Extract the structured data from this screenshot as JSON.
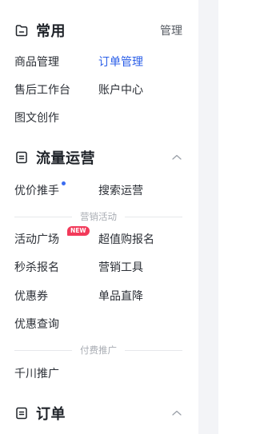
{
  "sections": {
    "common": {
      "title": "常用",
      "manage_label": "管理",
      "items": [
        "商品管理",
        "订单管理",
        "售后工作台",
        "账户中心",
        "图文创作"
      ]
    },
    "traffic": {
      "title": "流量运营",
      "items": [
        "优价推手",
        "搜索运营"
      ],
      "marketing_divider": "营销活动",
      "marketing_items": [
        "活动广场",
        "超值购报名",
        "秒杀报名",
        "营销工具",
        "优惠券",
        "单品直降",
        "优惠查询"
      ],
      "new_badge": "NEW",
      "paid_divider": "付费推广",
      "paid_items": [
        "千川推广"
      ]
    },
    "orders": {
      "title": "订单"
    }
  },
  "colors": {
    "active": "#2a5ee8",
    "badge": "#f23a5a",
    "dot": "#3b6cf0"
  },
  "icons": {
    "common": "folder-icon",
    "traffic": "list-box-icon",
    "orders": "list-box-icon",
    "collapse": "chevron-up-icon"
  },
  "state": {
    "active_item": "订单管理"
  }
}
